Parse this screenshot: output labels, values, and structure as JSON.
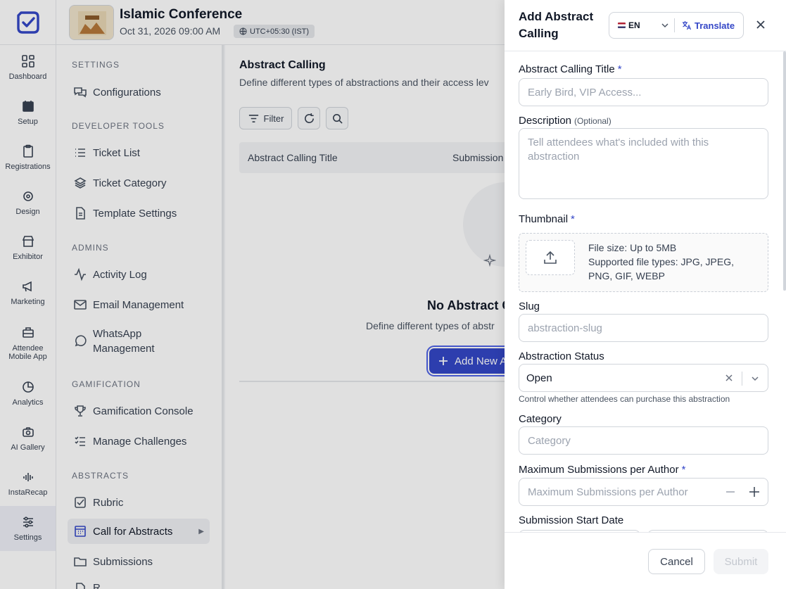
{
  "rail": {
    "items": [
      {
        "label": "Dashboard",
        "icon": "dashboard-icon"
      },
      {
        "label": "Setup",
        "icon": "calendar-icon"
      },
      {
        "label": "Registrations",
        "icon": "clipboard-icon"
      },
      {
        "label": "Design",
        "icon": "palette-icon"
      },
      {
        "label": "Exhibitor",
        "icon": "store-icon"
      },
      {
        "label": "Marketing",
        "icon": "megaphone-icon"
      },
      {
        "label": "Attendee Mobile App",
        "icon": "app-icon"
      },
      {
        "label": "Analytics",
        "icon": "pie-chart-icon"
      },
      {
        "label": "AI Gallery",
        "icon": "camera-icon"
      },
      {
        "label": "InstaRecap",
        "icon": "audio-wave-icon"
      },
      {
        "label": "Settings",
        "icon": "sliders-icon"
      }
    ]
  },
  "header": {
    "event_title": "Islamic Conference",
    "event_date": "Oct 31, 2026 09:00 AM",
    "timezone": "UTC+05:30 (IST)"
  },
  "sidebar": {
    "sections": {
      "settings": "SETTINGS",
      "developer_tools": "DEVELOPER TOOLS",
      "admins": "ADMINS",
      "gamification": "GAMIFICATION",
      "abstracts": "ABSTRACTS"
    },
    "items": {
      "configurations": "Configurations",
      "ticket_list": "Ticket List",
      "ticket_category": "Ticket Category",
      "template_settings": "Template Settings",
      "activity_log": "Activity Log",
      "email_management": "Email Management",
      "whatsapp_management": "WhatsApp Management",
      "gamification_console": "Gamification Console",
      "manage_challenges": "Manage Challenges",
      "rubric": "Rubric",
      "call_for_abstracts": "Call for Abstracts",
      "submissions": "Submissions",
      "partial": "R"
    }
  },
  "main": {
    "title": "Abstract Calling",
    "subtitle": "Define different types of abstractions and their access lev",
    "filter_label": "Filter",
    "columns": [
      "Abstract Calling Title",
      "Submission"
    ],
    "empty_title": "No Abstract C",
    "empty_subtitle": "Define different types of abstr",
    "add_button": "Add New A"
  },
  "drawer": {
    "title": "Add Abstract Calling",
    "language": "EN",
    "translate_label": "Translate",
    "fields": {
      "title_label": "Abstract Calling Title",
      "title_placeholder": "Early Bird, VIP Access...",
      "description_label": "Description",
      "description_optional": "(Optional)",
      "description_placeholder": "Tell attendees what's included with this abstraction",
      "thumbnail_label": "Thumbnail",
      "thumbnail_size": "File size: Up to 5MB",
      "thumbnail_types": "Supported file types: JPG, JPEG, PNG, GIF, WEBP",
      "slug_label": "Slug",
      "slug_placeholder": "abstraction-slug",
      "status_label": "Abstraction Status",
      "status_value": "Open",
      "status_help": "Control whether attendees can purchase this abstraction",
      "category_label": "Category",
      "category_placeholder": "Category",
      "max_label": "Maximum Submissions per Author",
      "max_placeholder": "Maximum Submissions per Author",
      "start_date_label": "Submission Start Date",
      "required_mark": "*"
    },
    "cancel_label": "Cancel",
    "submit_label": "Submit"
  },
  "colors": {
    "brand": "#3447c7",
    "required": "#3447c7"
  }
}
